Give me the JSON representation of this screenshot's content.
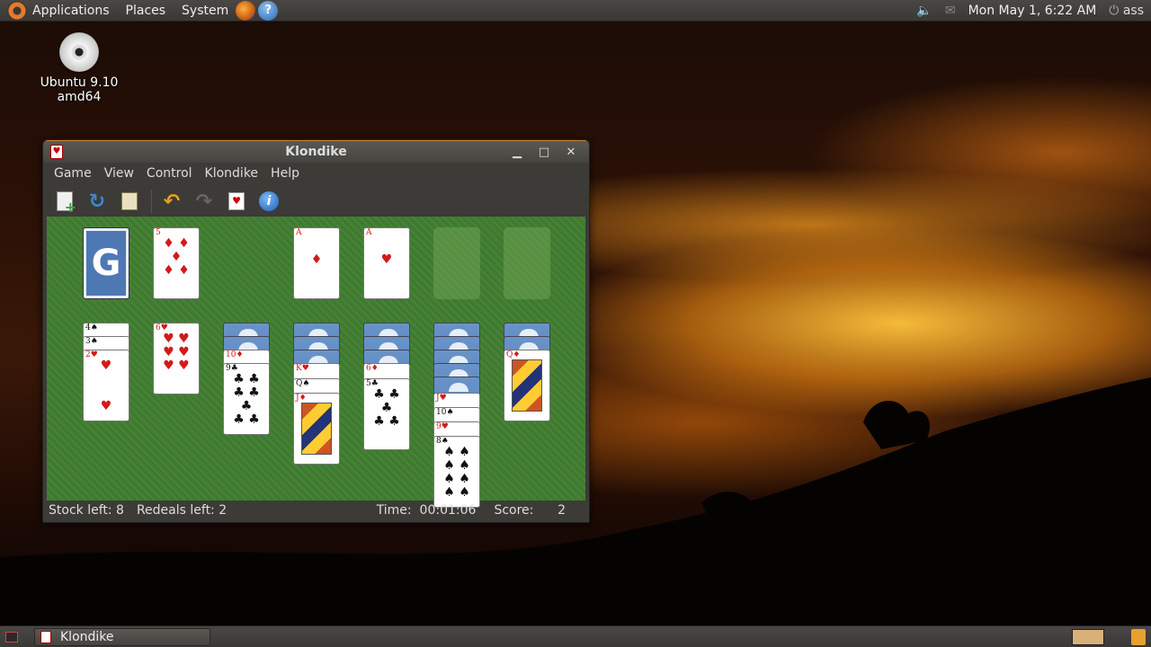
{
  "top_panel": {
    "menus": [
      "Applications",
      "Places",
      "System"
    ],
    "clock": "Mon May  1,  6:22 AM",
    "user": "ass"
  },
  "desktop": {
    "icon_label": "Ubuntu 9.10 amd64"
  },
  "window": {
    "title": "Klondike",
    "menu": [
      "Game",
      "View",
      "Control",
      "Klondike",
      "Help"
    ],
    "toolbar_icons": [
      "new-game-icon",
      "restart-icon",
      "hint-icon",
      "undo-icon",
      "redo-icon",
      "deal-icon",
      "info-icon"
    ]
  },
  "game": {
    "stock_mark": "G",
    "waste": {
      "rank": "5",
      "suit": "♦"
    },
    "foundations": [
      {
        "rank": "A",
        "suit": "♦"
      },
      {
        "rank": "A",
        "suit": "♥"
      }
    ],
    "tableau": [
      {
        "visible": [
          "4♠",
          "3♠",
          "2♥"
        ]
      },
      {
        "visible": [
          "6♥"
        ]
      },
      {
        "visible": [
          "10♦",
          "9♣"
        ]
      },
      {
        "visible": [
          "K♥",
          "Q♠",
          "J♦"
        ]
      },
      {
        "visible": [
          "6♦",
          "5♣"
        ]
      },
      {
        "visible": [
          "J♥",
          "10♠",
          "9♥",
          "8♠"
        ]
      },
      {
        "visible": [
          "Q♦"
        ]
      }
    ]
  },
  "status": {
    "stock": "Stock left: 8",
    "redeals": "Redeals left: 2",
    "time_label": "Time:",
    "time_value": "00:01:06",
    "score_label": "Score:",
    "score_value": "2"
  },
  "taskbar": {
    "task_label": "Klondike"
  },
  "colors": {
    "felt": "#3f7b2f",
    "card_back": "#4d78b4",
    "red_suit": "#d31a1a"
  }
}
